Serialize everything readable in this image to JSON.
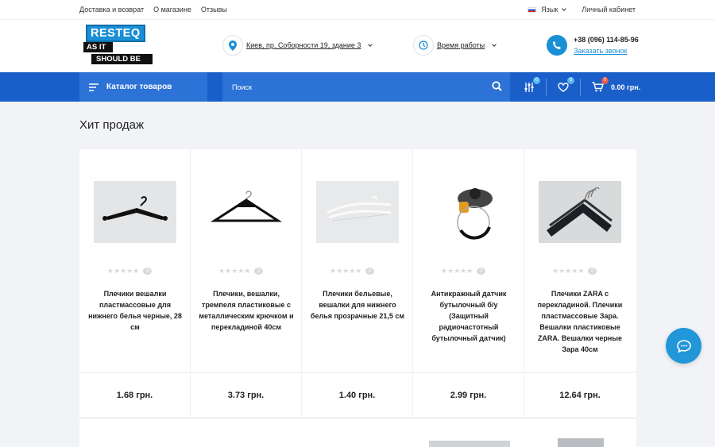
{
  "topbar": {
    "links": [
      "Доставка и возврат",
      "О магазине",
      "Отзывы"
    ],
    "language": "Язык",
    "account": "Личный кабинет"
  },
  "header": {
    "logo": {
      "line1": "RESTEQ",
      "line2": "AS IT",
      "line3": "SHOULD BE"
    },
    "address": "Киев, пр. Соборности 19, здание 3",
    "hours": "Время работы",
    "phone": "+38 (096) 114-85-96",
    "callback": "Заказать звонок"
  },
  "nav": {
    "catalog": "Каталог товаров",
    "search_placeholder": "Поиск",
    "compare_count": "0",
    "wishlist_count": "0",
    "cart_count": "0",
    "cart_total": "0.00 грн."
  },
  "section_title": "Хит продаж",
  "products": [
    {
      "name": "Плечики вешалки пластмассовые для нижнего белья черные, 28 см",
      "price": "1.68 грн.",
      "reviews": "0"
    },
    {
      "name": "Плечики, вешалки, тремпеля пластиковые с металлическим крючком и перекладиной 40см",
      "price": "3.73 грн.",
      "reviews": "0"
    },
    {
      "name": "Плечики бельевые, вешалки для нижнего белья прозрачные 21,5 см",
      "price": "1.40 грн.",
      "reviews": "0"
    },
    {
      "name": "Антикражный датчик бутылочный б/у (Защитный радиочастотный бутылочный датчик)",
      "price": "2.99 грн.",
      "reviews": "0"
    },
    {
      "name": "Плечики ZARA с перекладиной. Плечики пластмассовые Зара. Вешалки пластиковые ZARA. Вешалки черные Зара 40см",
      "price": "12.64 грн.",
      "reviews": "0"
    }
  ],
  "colors": {
    "nav_blue": "#1a5fc9",
    "accent": "#1a8fd6"
  }
}
